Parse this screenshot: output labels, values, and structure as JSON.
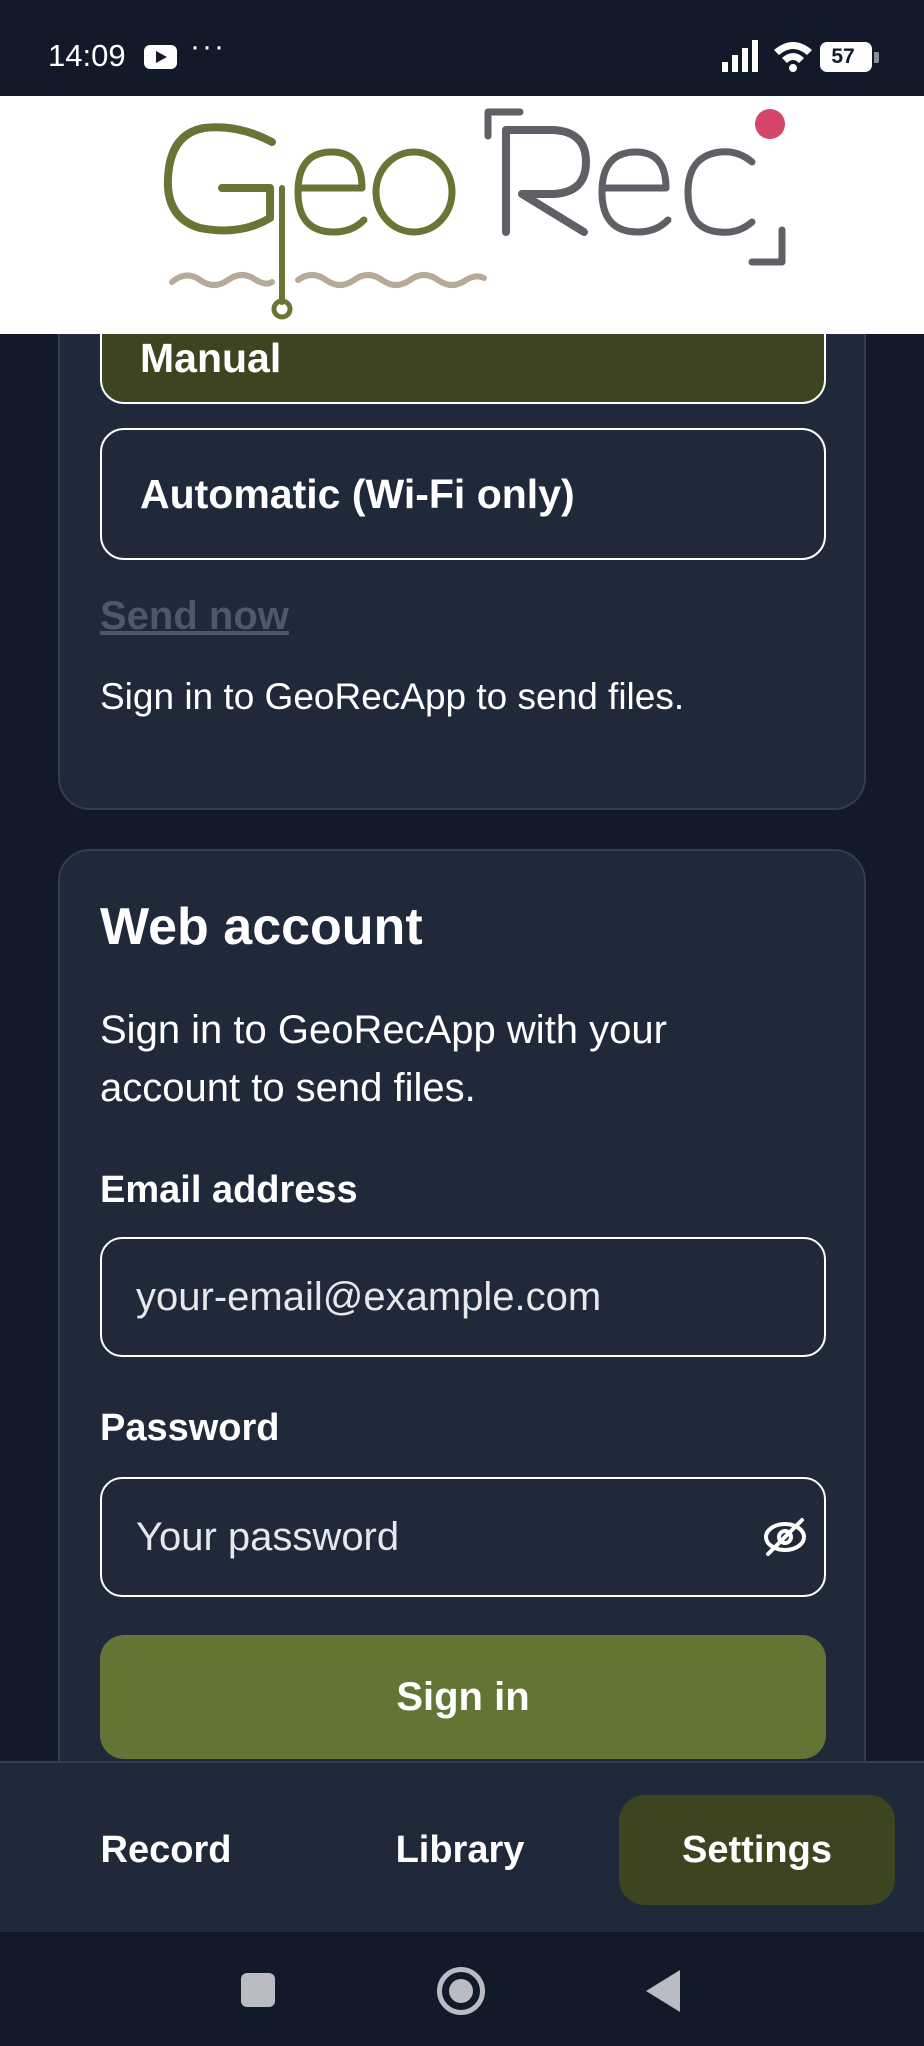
{
  "status_bar": {
    "time": "14:09",
    "battery": "57",
    "icons": [
      "youtube-icon",
      "more-dots-icon",
      "signal-icon",
      "wifi-icon",
      "battery-icon"
    ]
  },
  "header": {
    "logo_text_geo": "Geo",
    "logo_text_rec": "Rec",
    "colors": {
      "geo": "#687535",
      "rec": "#5f6066",
      "dot": "#d6456a",
      "wave": "#b7aa9a"
    }
  },
  "upload_mode": {
    "options": [
      {
        "label": "Manual",
        "selected": true
      },
      {
        "label": "Automatic (Wi-Fi only)",
        "selected": false
      }
    ],
    "send_now_label": "Send now",
    "hint": "Sign in to GeoRecApp to send files."
  },
  "web_account": {
    "title": "Web account",
    "description": "Sign in to GeoRecApp with your account to send files.",
    "email_label": "Email address",
    "email_placeholder": "your-email@example.com",
    "email_value": "",
    "password_label": "Password",
    "password_placeholder": "Your password",
    "password_value": "",
    "password_toggle_icon": "eye-off-icon",
    "sign_in_label": "Sign in"
  },
  "bottom_nav": {
    "tabs": [
      {
        "label": "Record",
        "active": false
      },
      {
        "label": "Library",
        "active": false
      },
      {
        "label": "Settings",
        "active": true
      }
    ]
  },
  "system_nav": {
    "buttons": [
      "recents-icon",
      "home-icon",
      "back-icon"
    ]
  },
  "colors": {
    "background": "#121a2a",
    "card": "#202939",
    "accent": "#637535",
    "selected": "#3d4520"
  }
}
